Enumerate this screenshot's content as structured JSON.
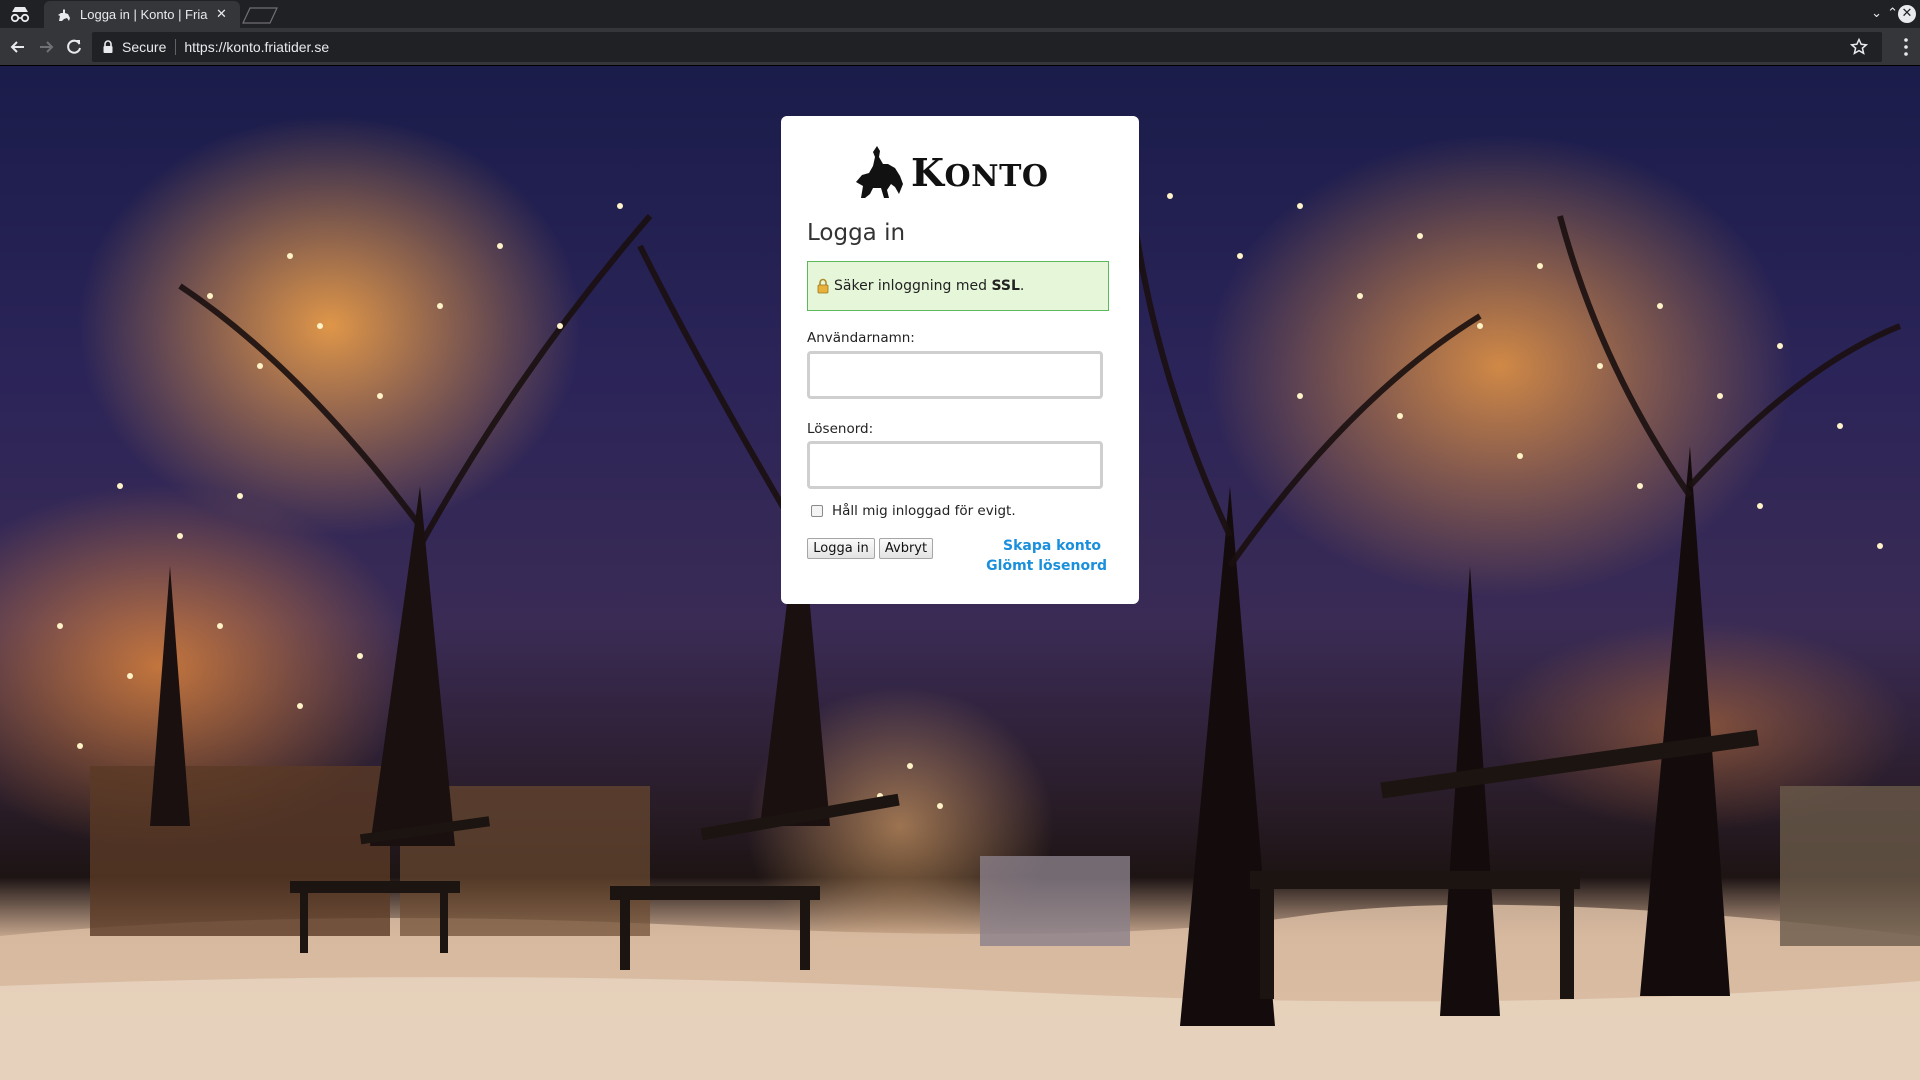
{
  "browser": {
    "tab_title": "Logga in | Konto | Fria",
    "secure_label": "Secure",
    "url": "https://konto.friatider.se",
    "icons": {
      "incognito": "incognito-icon",
      "favicon": "horse-rider-favicon",
      "tab_close": "close-icon",
      "back": "back-arrow-icon",
      "forward": "forward-arrow-icon",
      "reload": "reload-icon",
      "lock": "lock-icon",
      "bookmark": "star-icon",
      "menu": "kebab-menu-icon"
    }
  },
  "login": {
    "logo_text_first": "K",
    "logo_text_rest": "ONTO",
    "title": "Logga in",
    "ssl_prefix": "Säker inloggning med ",
    "ssl_bold": "SSL",
    "ssl_suffix": ".",
    "username_label": "Användarnamn:",
    "username_value": "",
    "password_label": "Lösenord:",
    "password_value": "",
    "remember_label": "Håll mig inloggad för evigt.",
    "remember_checked": false,
    "login_button": "Logga in",
    "cancel_button": "Avbryt",
    "create_account_link": "Skapa konto",
    "forgot_password_link": "Glömt lösenord"
  },
  "colors": {
    "link": "#1a8fdc",
    "ssl_box_bg": "#e6f7d9",
    "ssl_box_border": "#5cb85c"
  }
}
